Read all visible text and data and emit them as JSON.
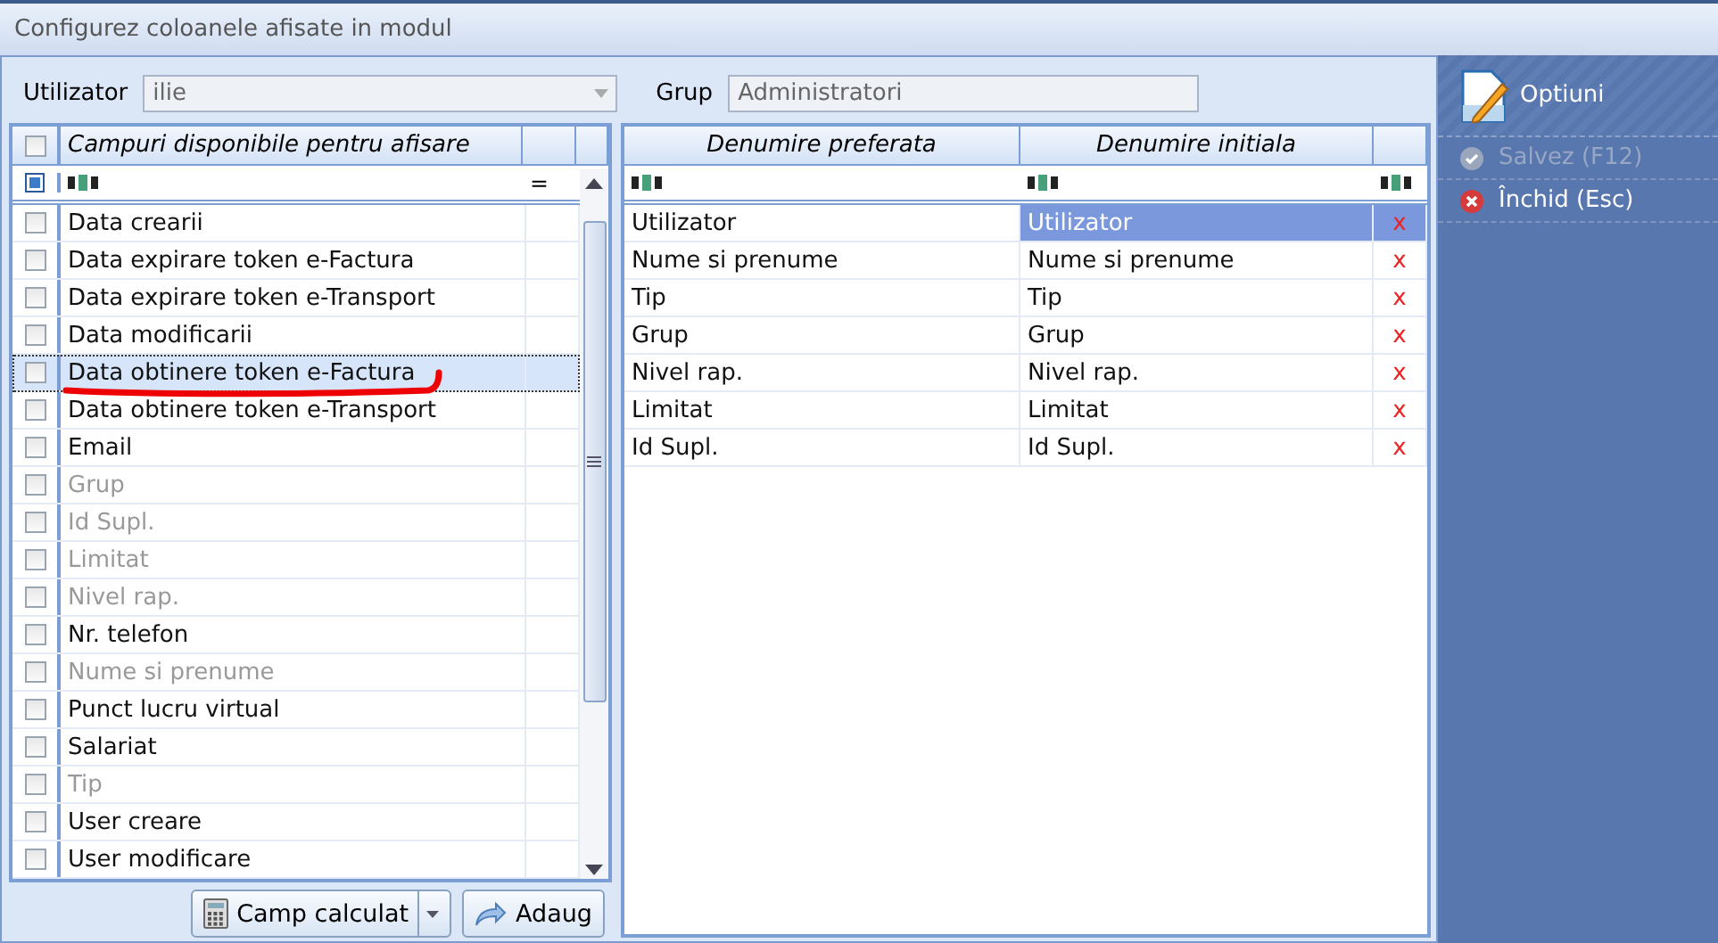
{
  "window": {
    "title": "Configurez coloanele afisate in modul"
  },
  "filters": [
    {
      "label": "Utilizator",
      "value": "ilie",
      "kind": "dropdown"
    },
    {
      "label": "Grup",
      "value": "Administratori",
      "kind": "text"
    }
  ],
  "available": {
    "header": "Campuri disponibile pentru afisare",
    "header_checked": false,
    "filter_operator": "=",
    "rows": [
      {
        "name": "Data crearii",
        "checked": false,
        "dimmed": false,
        "selected": false
      },
      {
        "name": "Data expirare token e-Factura",
        "checked": false,
        "dimmed": false,
        "selected": false
      },
      {
        "name": "Data expirare token e-Transport",
        "checked": false,
        "dimmed": false,
        "selected": false
      },
      {
        "name": "Data modificarii",
        "checked": false,
        "dimmed": false,
        "selected": false
      },
      {
        "name": "Data obtinere token e-Factura",
        "checked": false,
        "dimmed": false,
        "selected": true
      },
      {
        "name": "Data obtinere token e-Transport",
        "checked": false,
        "dimmed": false,
        "selected": false
      },
      {
        "name": "Email",
        "checked": false,
        "dimmed": false,
        "selected": false
      },
      {
        "name": "Grup",
        "checked": false,
        "dimmed": true,
        "selected": false
      },
      {
        "name": "Id Supl.",
        "checked": false,
        "dimmed": true,
        "selected": false
      },
      {
        "name": "Limitat",
        "checked": false,
        "dimmed": true,
        "selected": false
      },
      {
        "name": "Nivel rap.",
        "checked": false,
        "dimmed": true,
        "selected": false
      },
      {
        "name": "Nr. telefon",
        "checked": false,
        "dimmed": false,
        "selected": false
      },
      {
        "name": "Nume si prenume",
        "checked": false,
        "dimmed": true,
        "selected": false
      },
      {
        "name": "Punct lucru virtual",
        "checked": false,
        "dimmed": false,
        "selected": false
      },
      {
        "name": "Salariat",
        "checked": false,
        "dimmed": false,
        "selected": false
      },
      {
        "name": "Tip",
        "checked": false,
        "dimmed": true,
        "selected": false
      },
      {
        "name": "User creare",
        "checked": false,
        "dimmed": false,
        "selected": false
      },
      {
        "name": "User modificare",
        "checked": false,
        "dimmed": false,
        "selected": false
      }
    ],
    "buttons": [
      {
        "label": "Camp calculat",
        "kind": "split"
      },
      {
        "label": "Adaug",
        "kind": "plain"
      }
    ]
  },
  "chosen": {
    "columns": [
      "Denumire preferata",
      "Denumire initiala"
    ],
    "rows": [
      {
        "preferred": "Utilizator",
        "initial": "Utilizator",
        "remove": "x",
        "selected": true
      },
      {
        "preferred": "Nume si prenume",
        "initial": "Nume si prenume",
        "remove": "x",
        "selected": false
      },
      {
        "preferred": "Tip",
        "initial": "Tip",
        "remove": "x",
        "selected": false
      },
      {
        "preferred": "Grup",
        "initial": "Grup",
        "remove": "x",
        "selected": false
      },
      {
        "preferred": "Nivel rap.",
        "initial": "Nivel rap.",
        "remove": "x",
        "selected": false
      },
      {
        "preferred": "Limitat",
        "initial": "Limitat",
        "remove": "x",
        "selected": false
      },
      {
        "preferred": "Id Supl.",
        "initial": "Id Supl.",
        "remove": "x",
        "selected": false
      }
    ]
  },
  "sidebar": {
    "title": "Optiuni",
    "items": [
      {
        "label": "Salvez (F12)",
        "disabled": true,
        "kind": "save"
      },
      {
        "label": "Închid (Esc)",
        "disabled": false,
        "kind": "close"
      }
    ]
  }
}
